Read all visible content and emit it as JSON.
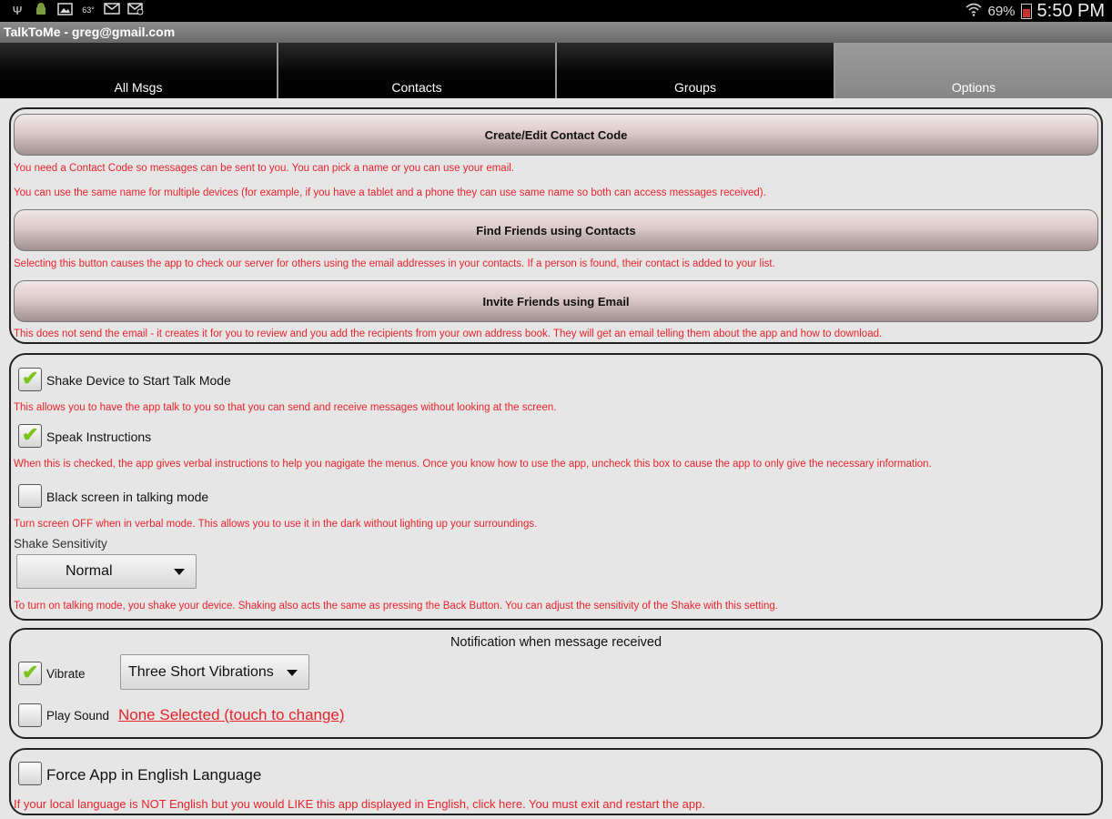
{
  "status_bar": {
    "battery_percent": "69%",
    "time": "5:50 PM",
    "left_icons": [
      "usb-icon",
      "android-icon",
      "image-icon",
      "weather-icon",
      "mail-icon",
      "mail-alt-icon"
    ],
    "temp": "63°"
  },
  "app_title": "TalkToMe - greg@gmail.com",
  "tabs": [
    {
      "label": "All Msgs",
      "active": false
    },
    {
      "label": "Contacts",
      "active": false
    },
    {
      "label": "Groups",
      "active": false
    },
    {
      "label": "Options",
      "active": true
    }
  ],
  "section_contacts": {
    "create_button": "Create/Edit Contact Code",
    "create_help_1": "You need a Contact Code so messages can be sent to you. You can pick a name or you can use your email.",
    "create_help_2": "You can use the same name for multiple devices (for example, if you have a tablet and a phone they can use same name so both can access messages received).",
    "find_button": "Find Friends using Contacts",
    "find_help": "Selecting this button causes the app to check our server for others using the email addresses in your contacts. If a person is found, their contact is added to your list.",
    "invite_button": "Invite Friends using Email",
    "invite_help": "This does not send the email - it creates it for you to review and you add the recipients from your own address book. They will get an email telling them about the app and how to download."
  },
  "section_talk": {
    "shake_label": "Shake Device to Start Talk Mode",
    "shake_checked": true,
    "shake_help": "This allows you to have the app talk to you so that you can send and receive messages without looking at the screen.",
    "speak_label": "Speak Instructions",
    "speak_checked": true,
    "speak_help": "When this is checked, the app gives verbal instructions to help you nagigate the menus. Once you know how to use the app, uncheck this box to cause the app to only give the necessary information.",
    "black_label": "Black screen in talking mode",
    "black_checked": false,
    "black_help": "Turn screen OFF when in verbal mode. This allows you to use it in the dark without lighting up your surroundings.",
    "sensitivity_label": "Shake Sensitivity",
    "sensitivity_value": "Normal",
    "sensitivity_help": "To turn on talking mode, you shake your device. Shaking also acts the same as pressing the Back Button. You can adjust the sensitivity of the Shake with this setting."
  },
  "section_notify": {
    "heading": "Notification when message received",
    "vibrate_label": "Vibrate",
    "vibrate_checked": true,
    "vibrate_value": "Three Short Vibrations",
    "sound_label": "Play Sound",
    "sound_checked": false,
    "sound_link": "None Selected (touch to change)"
  },
  "section_lang": {
    "english_label": "Force App in English Language",
    "english_checked": false,
    "english_help": "If your local language is NOT English but you would LIKE this app displayed in English, click here. You must exit and restart the app."
  },
  "colors": {
    "help_text": "#e8232b",
    "check": "#7cc41c",
    "active_tab": "#8f8f8f"
  }
}
